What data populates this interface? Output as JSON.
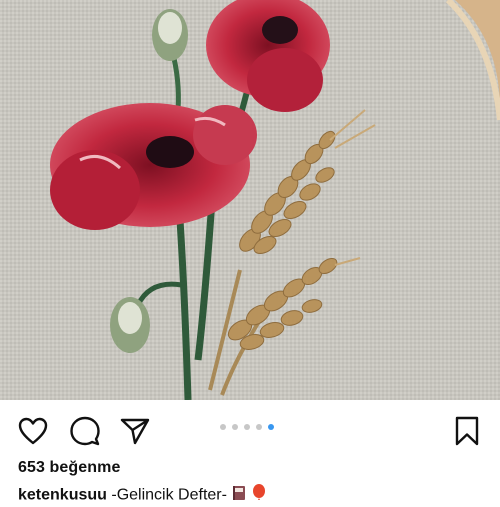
{
  "post": {
    "image_alt": "Embroidered poppies and wheat on linen fabric",
    "carousel": {
      "count": 5,
      "active_index": 4
    },
    "likes_text": "653 beğenme",
    "caption": {
      "username": "ketenkusuu",
      "text": " -Gelincik Defter-",
      "emojis": [
        "notebook-emoji",
        "balloon-emoji"
      ]
    }
  },
  "actions": {
    "like": "heart-icon",
    "comment": "comment-icon",
    "share": "send-icon",
    "save": "bookmark-icon"
  },
  "colors": {
    "carousel_active": "#3897f0",
    "carousel_inactive": "#c7c7c7",
    "poppy_red": "#b8223a",
    "wheat": "#b8935c",
    "linen": "#c9c7c0"
  }
}
